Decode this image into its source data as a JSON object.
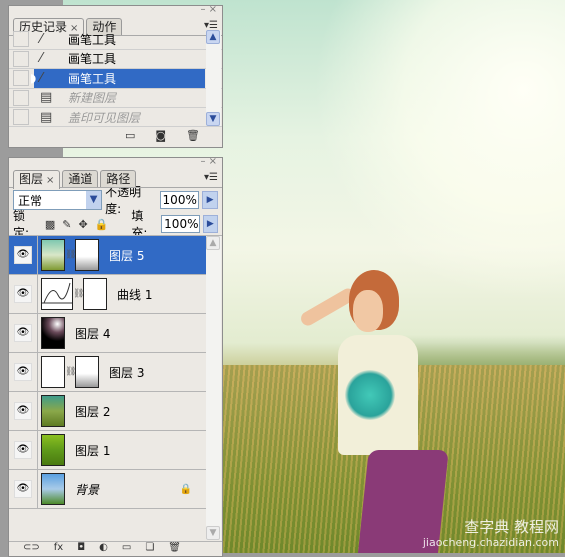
{
  "history_panel": {
    "tabs": [
      {
        "label": "历史记录",
        "active": true,
        "close": "×"
      },
      {
        "label": "动作",
        "active": false
      }
    ],
    "items": [
      {
        "label": "画笔工具",
        "icon": "brush-icon",
        "selected": false,
        "dim": false
      },
      {
        "label": "画笔工具",
        "icon": "brush-icon",
        "selected": false,
        "dim": false
      },
      {
        "label": "画笔工具",
        "icon": "brush-icon",
        "selected": true,
        "dim": false
      },
      {
        "label": "新建图层",
        "icon": "document-icon",
        "selected": false,
        "dim": true
      },
      {
        "label": "盖印可见图层",
        "icon": "document-icon",
        "selected": false,
        "dim": true
      }
    ],
    "footer_icons": [
      "new-document-from-state-icon",
      "snapshot-icon",
      "trash-icon"
    ]
  },
  "layers_panel": {
    "tabs": [
      {
        "label": "图层",
        "active": true,
        "close": "×"
      },
      {
        "label": "通道",
        "active": false
      },
      {
        "label": "路径",
        "active": false
      }
    ],
    "blend_mode": "正常",
    "opacity_label": "不透明度:",
    "opacity": "100%",
    "lock_label": "锁定:",
    "fill_label": "填充:",
    "fill": "100%",
    "layers": [
      {
        "name": "图层 5",
        "selected": true,
        "mask": true,
        "thumb": "photo"
      },
      {
        "name": "曲线 1",
        "selected": false,
        "mask": true,
        "thumb": "curves"
      },
      {
        "name": "图层 4",
        "selected": false,
        "mask": false,
        "thumb": "dark"
      },
      {
        "name": "图层 3",
        "selected": false,
        "mask": true,
        "thumb": "white"
      },
      {
        "name": "图层 2",
        "selected": false,
        "mask": false,
        "thumb": "photo2"
      },
      {
        "name": "图层 1",
        "selected": false,
        "mask": false,
        "thumb": "green"
      },
      {
        "name": "背景",
        "selected": false,
        "mask": false,
        "thumb": "original",
        "locked": true
      }
    ]
  },
  "watermark": {
    "line1": "查字典 教程网",
    "line2": "jiaocheng.chazidian.com"
  },
  "colors": {
    "selection": "#316ac5",
    "panel": "#ece9e4"
  }
}
